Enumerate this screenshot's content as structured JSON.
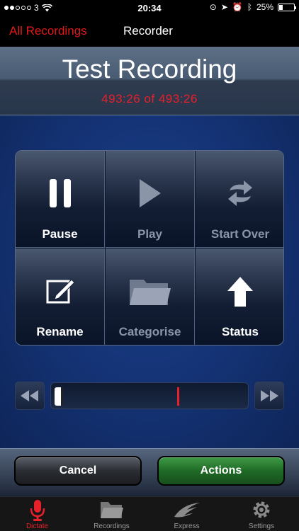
{
  "status_bar": {
    "carrier": "3",
    "time": "20:34",
    "battery": "25%",
    "battery_level": 0.25
  },
  "nav": {
    "back_label": "All Recordings",
    "title": "Recorder"
  },
  "recording": {
    "title": "Test Recording",
    "time_current": "493:26",
    "time_sep": "of",
    "time_total": "493:26"
  },
  "controls": {
    "pause": "Pause",
    "play": "Play",
    "start_over": "Start Over",
    "rename": "Rename",
    "categorise": "Categorise",
    "status": "Status"
  },
  "scrubber": {
    "position": 0.0,
    "marker_position": 0.67
  },
  "buttons": {
    "cancel": "Cancel",
    "actions": "Actions"
  },
  "tabs": [
    {
      "label": "Dictate",
      "icon": "microphone-icon",
      "active": true
    },
    {
      "label": "Recordings",
      "icon": "folder-icon",
      "active": false
    },
    {
      "label": "Express",
      "icon": "express-wing-icon",
      "active": false
    },
    {
      "label": "Settings",
      "icon": "gear-icon",
      "active": false
    }
  ],
  "colors": {
    "accent_red": "#e8202a",
    "actions_green": "#1f6a27"
  }
}
